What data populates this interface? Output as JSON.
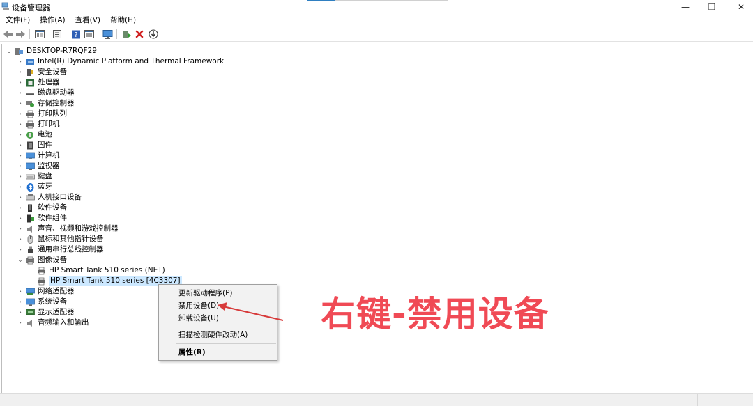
{
  "window": {
    "title": "设备管理器",
    "minimize": "—",
    "maximize": "❐",
    "close": "✕"
  },
  "menu": [
    "文件(F)",
    "操作(A)",
    "查看(V)",
    "帮助(H)"
  ],
  "toolbar": {
    "icons": [
      "back-icon",
      "forward-icon",
      "view-icon",
      "properties-icon",
      "help-icon",
      "action-icon",
      "monitor-icon",
      "update-driver-icon",
      "uninstall-icon",
      "scan-icon"
    ]
  },
  "tree": {
    "root": "DESKTOP-R7RQF29",
    "items": [
      {
        "label": "Intel(R) Dynamic Platform and Thermal Framework",
        "icon": "thermal-icon",
        "expanded": false
      },
      {
        "label": "安全设备",
        "icon": "security-key-icon",
        "expanded": false
      },
      {
        "label": "处理器",
        "icon": "processor-icon",
        "expanded": false
      },
      {
        "label": "磁盘驱动器",
        "icon": "disk-drive-icon",
        "expanded": false
      },
      {
        "label": "存储控制器",
        "icon": "storage-controller-icon",
        "expanded": false
      },
      {
        "label": "打印队列",
        "icon": "print-queue-icon",
        "expanded": false
      },
      {
        "label": "打印机",
        "icon": "printer-icon",
        "expanded": false
      },
      {
        "label": "电池",
        "icon": "battery-icon",
        "expanded": false
      },
      {
        "label": "固件",
        "icon": "firmware-icon",
        "expanded": false
      },
      {
        "label": "计算机",
        "icon": "computer-icon",
        "expanded": false
      },
      {
        "label": "监视器",
        "icon": "monitor-icon",
        "expanded": false
      },
      {
        "label": "键盘",
        "icon": "keyboard-icon",
        "expanded": false
      },
      {
        "label": "蓝牙",
        "icon": "bluetooth-icon",
        "expanded": false
      },
      {
        "label": "人机接口设备",
        "icon": "hid-icon",
        "expanded": false
      },
      {
        "label": "软件设备",
        "icon": "software-device-icon",
        "expanded": false
      },
      {
        "label": "软件组件",
        "icon": "software-component-icon",
        "expanded": false
      },
      {
        "label": "声音、视频和游戏控制器",
        "icon": "speaker-icon",
        "expanded": false
      },
      {
        "label": "鼠标和其他指针设备",
        "icon": "mouse-icon",
        "expanded": false
      },
      {
        "label": "通用串行总线控制器",
        "icon": "usb-icon",
        "expanded": false
      },
      {
        "label": "图像设备",
        "icon": "imaging-device-icon",
        "expanded": true,
        "children": [
          {
            "label": "HP Smart Tank 510 series (NET)",
            "icon": "printer-icon"
          },
          {
            "label": "HP Smart Tank 510 series [4C3307]",
            "icon": "printer-icon",
            "selected": true
          }
        ]
      },
      {
        "label": "网络适配器",
        "icon": "network-adapter-icon",
        "expanded": false
      },
      {
        "label": "系统设备",
        "icon": "system-device-icon",
        "expanded": false
      },
      {
        "label": "显示适配器",
        "icon": "display-adapter-icon",
        "expanded": false
      },
      {
        "label": "音频输入和输出",
        "icon": "audio-io-icon",
        "expanded": false
      }
    ]
  },
  "context_menu": {
    "items": [
      "更新驱动程序(P)",
      "禁用设备(D)",
      "卸载设备(U)",
      "扫描检测硬件改动(A)",
      "属性(R)"
    ]
  },
  "annotation": {
    "text": "右键-禁用设备",
    "color": "#f04a55"
  },
  "colors": {
    "selection": "#cce8ff",
    "accent": "#2f7fc1"
  }
}
